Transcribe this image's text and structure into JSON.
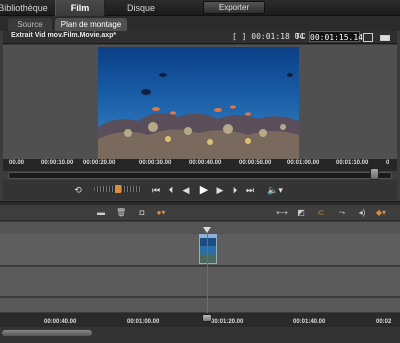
{
  "tabs": {
    "bibliotheque": "Bibliothèque",
    "film": "Film",
    "disque": "Disque",
    "export": "Exporter"
  },
  "subtabs": {
    "source": "Source",
    "plan": "Plan de montage"
  },
  "player": {
    "title": "Extrait Vid mov.Film.Movie.axp*",
    "duration": "[ ] 00:01:18 04",
    "tc_label": "TC",
    "timecode": "00:01:15.14"
  },
  "ruler_top": [
    "00.00",
    "00:00:10.00",
    "00:00:20.00",
    "00:00:30.00",
    "00:00:40.00",
    "00:00:50.00",
    "00:01:00.00",
    "00:01:10.00",
    "0"
  ],
  "ruler_bottom": [
    "00:00:40.00",
    "00:01:00.00",
    "00:01:20.00",
    "00:01:40.00",
    "00:02"
  ],
  "colors": {
    "accent": "#d98c3a",
    "playhead": "#e03a3a"
  }
}
